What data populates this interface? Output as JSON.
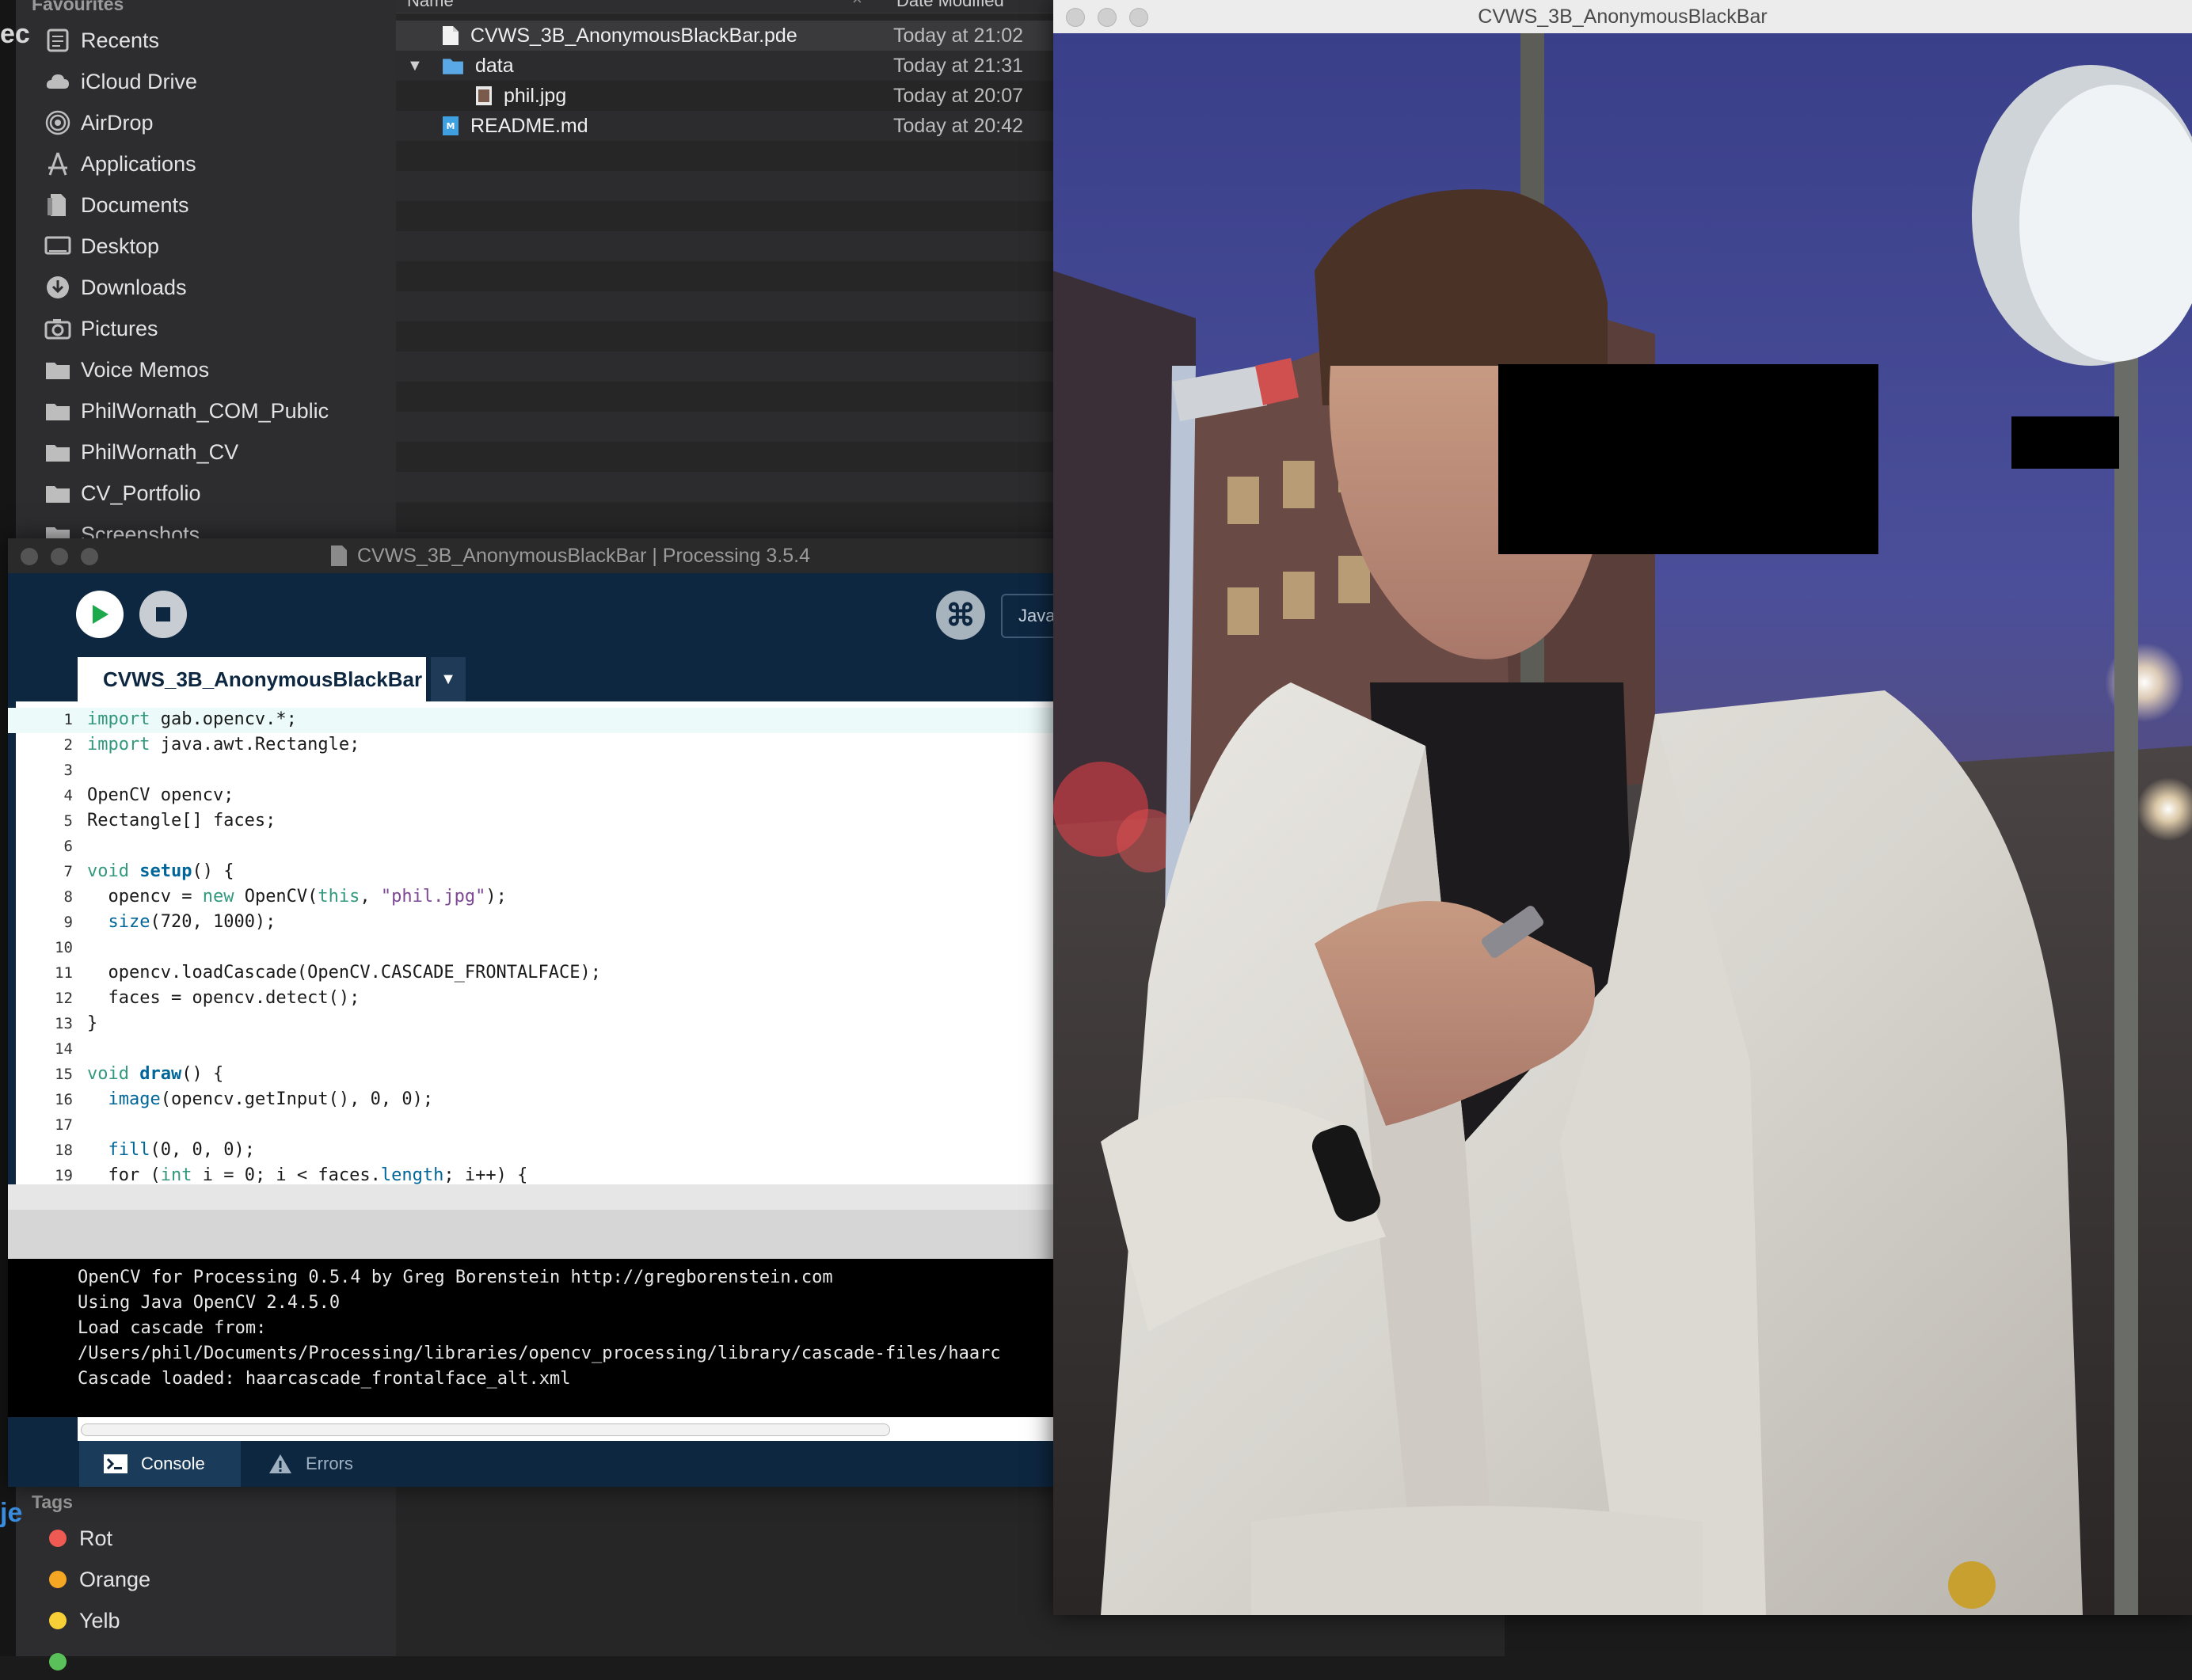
{
  "finder": {
    "favourites_label": "Favourites",
    "sidebar": [
      {
        "label": "Recents",
        "icon": "clock-icon"
      },
      {
        "label": "iCloud Drive",
        "icon": "cloud-icon"
      },
      {
        "label": "AirDrop",
        "icon": "airdrop-icon"
      },
      {
        "label": "Applications",
        "icon": "applications-icon"
      },
      {
        "label": "Documents",
        "icon": "documents-icon"
      },
      {
        "label": "Desktop",
        "icon": "desktop-icon"
      },
      {
        "label": "Downloads",
        "icon": "download-icon"
      },
      {
        "label": "Pictures",
        "icon": "camera-icon"
      },
      {
        "label": "Voice Memos",
        "icon": "folder-icon"
      },
      {
        "label": "PhilWornath_COM_Public",
        "icon": "folder-icon"
      },
      {
        "label": "PhilWornath_CV",
        "icon": "folder-icon"
      },
      {
        "label": "CV_Portfolio",
        "icon": "folder-icon"
      },
      {
        "label": "Screenshots",
        "icon": "folder-icon"
      }
    ],
    "tags_label": "Tags",
    "tags": [
      {
        "label": "Rot",
        "color": "#ef5a52"
      },
      {
        "label": "Orange",
        "color": "#f5a623"
      },
      {
        "label": "Yelb",
        "color": "#f7d038"
      },
      {
        "label": "",
        "color": "#5ac15a"
      }
    ],
    "columns": {
      "name": "Name",
      "date": "Date Modified"
    },
    "files": [
      {
        "name": "CVWS_3B_AnonymousBlackBar.pde",
        "date": "Today at 21:02",
        "icon": "document-icon",
        "indent": 0
      },
      {
        "name": "data",
        "date": "Today at 21:31",
        "icon": "folder-icon",
        "indent": 0
      },
      {
        "name": "phil.jpg",
        "date": "Today at 20:07",
        "icon": "image-icon",
        "indent": 1
      },
      {
        "name": "README.md",
        "date": "Today at 20:42",
        "icon": "markdown-icon",
        "indent": 0
      }
    ]
  },
  "processing": {
    "window_title": "CVWS_3B_AnonymousBlackBar | Processing 3.5.4",
    "mode_label": "Java",
    "tab_label": "CVWS_3B_AnonymousBlackBar",
    "code_lines": [
      "import gab.opencv.*;",
      "import java.awt.Rectangle;",
      "",
      "OpenCV opencv;",
      "Rectangle[] faces;",
      "",
      "void setup() {",
      "  opencv = new OpenCV(this, \"phil.jpg\");",
      "  size(720, 1000);",
      "",
      "  opencv.loadCascade(OpenCV.CASCADE_FRONTALFACE);",
      "  faces = opencv.detect();",
      "}",
      "",
      "void draw() {",
      "  image(opencv.getInput(), 0, 0);",
      "",
      "  fill(0, 0, 0);",
      "  for (int i = 0; i < faces.length; i++) {"
    ],
    "console_text": "OpenCV for Processing 0.5.4 by Greg Borenstein http://gregborenstein.com\nUsing Java OpenCV 2.4.5.0\nLoad cascade from:\n/Users/phil/Documents/Processing/libraries/opencv_processing/library/cascade-files/haarc\nCascade loaded: haarcascade_frontalface_alt.xml",
    "console_tab": "Console",
    "errors_tab": "Errors"
  },
  "sketch": {
    "window_title": "CVWS_3B_AnonymousBlackBar"
  }
}
